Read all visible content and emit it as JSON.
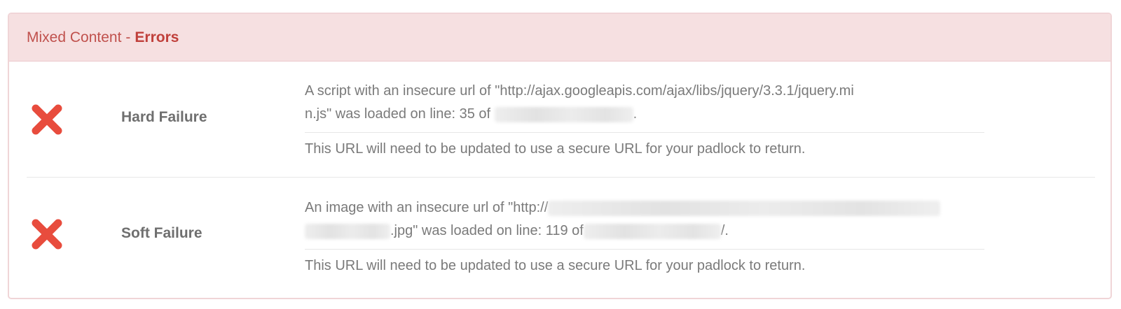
{
  "panel": {
    "title_prefix": "Mixed Content",
    "title_separator": "-",
    "title_emphasis": "Errors"
  },
  "colors": {
    "error_red": "#e84c3d",
    "header_bg": "#f6e0e1",
    "header_text": "#c0514d"
  },
  "rows": [
    {
      "icon": "x-icon",
      "label": "Hard Failure",
      "message_line1": "A script with an insecure url of \"http://ajax.googleapis.com/ajax/libs/jquery/3.3.1/jquery.mi",
      "message_line2_prefix": "n.js\" was loaded on line: 35 of",
      "message_line2_suffix": ".",
      "note": "This URL will need to be updated to use a secure URL for your padlock to return."
    },
    {
      "icon": "x-icon",
      "label": "Soft Failure",
      "message_line1_prefix": "An image with an insecure url of \"http://",
      "message_line2_middle": ".jpg\" was loaded on line: 119 of",
      "message_line2_suffix": "/.",
      "note": "This URL will need to be updated to use a secure URL for your padlock to return."
    }
  ]
}
